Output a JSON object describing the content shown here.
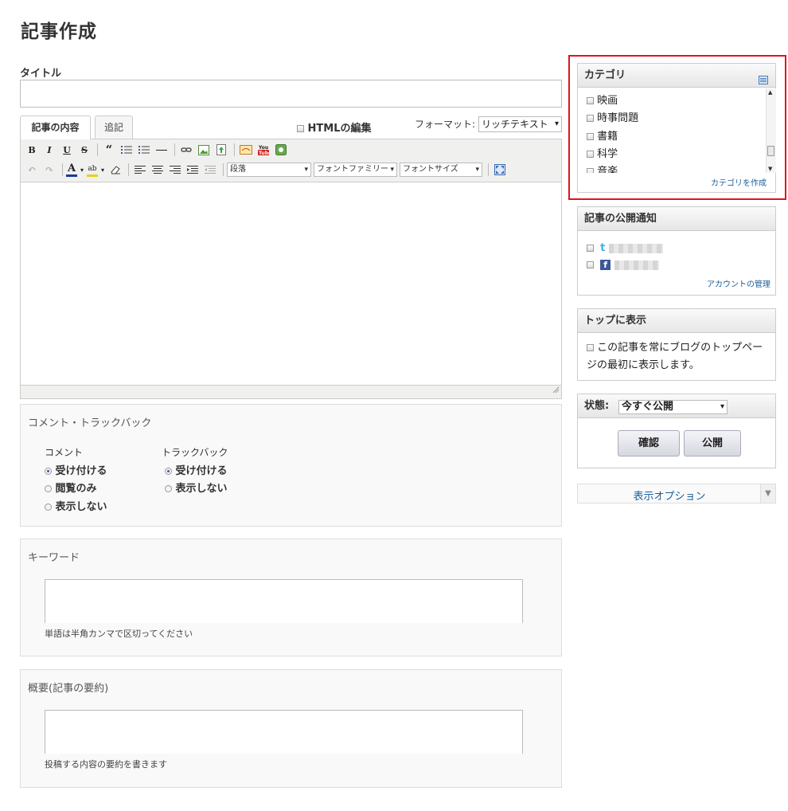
{
  "page": {
    "title": "記事作成"
  },
  "form": {
    "title_label": "タイトル",
    "title_value": ""
  },
  "editor": {
    "tabs": [
      {
        "label": "記事の内容",
        "active": true
      },
      {
        "label": "追記",
        "active": false
      }
    ],
    "html_edit_label": "HTMLの編集",
    "format_label": "フォーマット:",
    "format_value": "リッチテキスト",
    "toolbar_selects": {
      "paragraph": "段落",
      "font_family": "フォントファミリー",
      "font_size": "フォントサイズ"
    }
  },
  "comment_trackback": {
    "title": "コメント・トラックバック",
    "comment": {
      "label": "コメント",
      "options": [
        "受け付ける",
        "閲覧のみ",
        "表示しない"
      ],
      "selected": "受け付ける"
    },
    "trackback": {
      "label": "トラックバック",
      "options": [
        "受け付ける",
        "表示しない"
      ],
      "selected": "受け付ける"
    }
  },
  "keyword": {
    "title": "キーワード",
    "value": "",
    "hint": "単語は半角カンマで区切ってください"
  },
  "summary": {
    "title": "概要(記事の要約)",
    "value": "",
    "hint": "投稿する内容の要約を書きます"
  },
  "sidebar": {
    "category": {
      "title": "カテゴリ",
      "items": [
        "映画",
        "時事問題",
        "書籍",
        "科学",
        "音楽"
      ],
      "create_link": "カテゴリを作成"
    },
    "publish_notice": {
      "title": "記事の公開通知",
      "manage_link": "アカウントの管理"
    },
    "top_display": {
      "title": "トップに表示",
      "checkbox_line1": "この記事を常にブログのトップペー",
      "checkbox_line2": "ジの最初に表示します。"
    },
    "status": {
      "label": "状態:",
      "value": "今すぐ公開",
      "confirm_button": "確認",
      "publish_button": "公開"
    },
    "display_options": "表示オプション"
  },
  "colors": {
    "highlight_border": "#e0141e",
    "link": "#1a5f9a"
  }
}
